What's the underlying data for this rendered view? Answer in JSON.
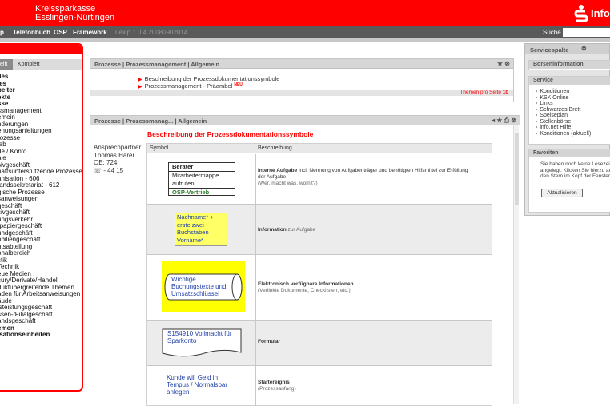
{
  "header": {
    "bank_line1": "Kreissparkasse",
    "bank_line2": "Esslingen-Nürtingen",
    "logo_text": "Info"
  },
  "nav": {
    "items": [
      "p",
      "Telefonbuch",
      "OSP",
      "Framework"
    ],
    "version": "Lexip 1.0.4.20080902014",
    "search_label": "Suche",
    "search_value": ""
  },
  "left": {
    "tabs": [
      "eift",
      "Komplett"
    ],
    "items": [
      {
        "t": "lles",
        "b": true
      },
      {
        "t": "les",
        "b": true
      },
      {
        "t": "beiter",
        "b": true
      },
      {
        "t": "ekte",
        "b": true
      },
      {
        "t": "sse",
        "b": true
      },
      {
        "t": "ssmanagement",
        "b": false
      },
      {
        "t": "emein",
        "b": false
      },
      {
        "t": "nderungen",
        "b": false
      },
      {
        "t": "enungsanleitungen",
        "b": false
      },
      {
        "t": "rozesse",
        "b": false
      },
      {
        "t": "ieb",
        "b": false
      },
      {
        "t": "de / Konto",
        "b": false
      },
      {
        "t": "ale",
        "b": false
      },
      {
        "t": "sivgeschäft",
        "b": false
      },
      {
        "t": "häftsunterstützende Prozesse",
        "b": false
      },
      {
        "t": "anisation - 606",
        "b": false
      },
      {
        "t": "tandssekretariat - 612",
        "b": false
      },
      {
        "t": "gische Prozesse",
        "b": false
      },
      {
        "t": "sanweisungen",
        "b": false
      },
      {
        "t": "geschäft",
        "b": false
      },
      {
        "t": "sivgeschäft",
        "b": false
      },
      {
        "t": "ungsverkehr",
        "b": false
      },
      {
        "t": "rpapiergeschäft",
        "b": false
      },
      {
        "t": "undgeschäft",
        "b": false
      },
      {
        "t": "obiliengeschäft",
        "b": false
      },
      {
        "t": "ntsabteilung",
        "b": false
      },
      {
        "t": "onalbereich",
        "b": false
      },
      {
        "t": "stik",
        "b": false
      },
      {
        "t": "Technik",
        "b": false
      },
      {
        "t": "eue Medien",
        "b": false
      },
      {
        "t": "sury/Derivate/Handel",
        "b": false
      },
      {
        "t": "duktübergreifende Themen",
        "b": false
      },
      {
        "t": "aden für Arbeitsanweisungen",
        "b": false
      },
      {
        "t": "äude",
        "b": false
      },
      {
        "t": "lsteistungsgeschäft",
        "b": false
      },
      {
        "t": "ssen-/Filialgeschäft",
        "b": false
      },
      {
        "t": "andsgeschäft",
        "b": false
      },
      {
        "t": "emen",
        "b": true
      },
      {
        "t": "isationseinheiten",
        "b": true
      }
    ]
  },
  "panel1": {
    "title": "Prozesse | Prozessmanagement | Allgemein",
    "links": [
      "Beschreibung der Prozessdokumentationssymbole",
      "Prozessmanagement - Präambel"
    ],
    "badge": "NEU",
    "per_page_label": "Themen pro Seite",
    "per_page": "10"
  },
  "panel2": {
    "title": "Prozesse | Prozessmanag... | Allgemein",
    "doc_title": "Beschreibung der Prozessdokumentationssymbole",
    "contact": [
      "Ansprechpartner:",
      "Thomas Harer",
      "OE: 724",
      "☏ - 44 15"
    ],
    "col_symbol": "Symbol",
    "col_desc": "Beschreibung",
    "rows": [
      {
        "symbol_lines": [
          "Berater",
          "Mitarbeitermappe",
          "aufrufen",
          "OSP-Vertrieb"
        ],
        "title": "Interne Aufgabe",
        "desc": "incl. Nennung von Aufgabenträger und benötigten Hilfsmittel zur Erfüllung",
        "desc2": "der Aufgabe",
        "sub": "(Wer, macht was, womit?)"
      },
      {
        "symbol_lines": [
          "Nachname* +",
          "erste zwei",
          "Buchstaben",
          "Vorname*"
        ],
        "title": "Information",
        "desc": "zur Aufgabe",
        "desc2": "",
        "sub": ""
      },
      {
        "symbol_lines": [
          "Wichtige",
          "Buchungstexte und",
          "Umsatzschlüssel"
        ],
        "title": "Elektronisch verfügbare Informationen",
        "desc": "",
        "desc2": "",
        "sub": "(Verlinkte Dokumente, Checklisten, etc.)"
      },
      {
        "symbol_lines": [
          "S154910 Vollmacht für",
          "Sparkonto"
        ],
        "title": "Formular",
        "desc": "",
        "desc2": "",
        "sub": ""
      },
      {
        "symbol_lines": [
          "Kunde will Geld in",
          "Tempus / Normalspar",
          "anlegen"
        ],
        "title": "Startereignis",
        "desc": "",
        "desc2": "",
        "sub": "(Prozessanfang)"
      }
    ]
  },
  "right": {
    "title": "Servicespalte",
    "boersen": "Börseninformation",
    "service_title": "Service",
    "service_items": [
      "Konditionen",
      "KSK Online",
      "Links",
      "Schwarzes Brett",
      "Speiseplan",
      "Stellenbörse",
      "info.net Hilfe",
      "Konditionen (aktuell)"
    ],
    "fav_title": "Favoriten",
    "fav_text": [
      "Sie haben noch keine Lesezei",
      "angelegt. Klicken Sie hierzu au",
      "den Stern im Kopf der Fenster."
    ],
    "fav_button": "Aktualisieren"
  },
  "colors": {
    "brand_red": "#ff0000",
    "nav_grey": "#5a5a5a",
    "symbol_yellow": "#ffff00",
    "green_text": "#2a7a2a",
    "blue_text": "#1f3ea8"
  }
}
